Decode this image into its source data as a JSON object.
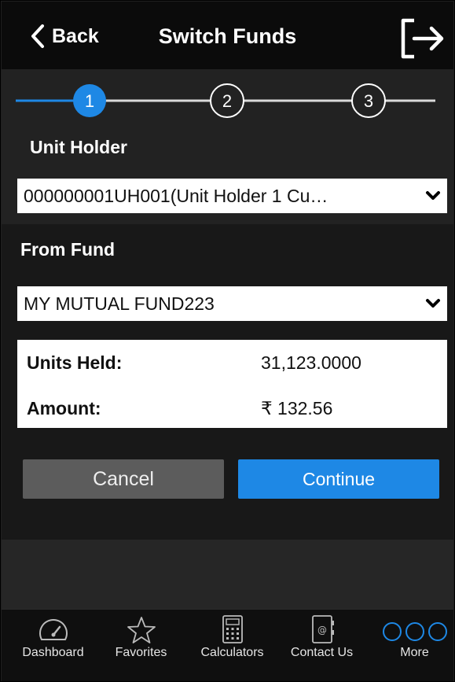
{
  "header": {
    "back_label": "Back",
    "title": "Switch Funds",
    "logout_icon": "logout-icon"
  },
  "stepper": {
    "steps": [
      "1",
      "2",
      "3"
    ],
    "active_step": 1,
    "active_color": "#1e88e5"
  },
  "unit_holder": {
    "label": "Unit Holder",
    "value": "000000001UH001(Unit Holder 1 Cu…"
  },
  "from_fund": {
    "label": "From Fund",
    "value": "MY MUTUAL FUND223"
  },
  "holding": {
    "units_label": "Units Held:",
    "units_value": "31,123.0000",
    "amount_label": "Amount:",
    "amount_value": "₹ 132.56"
  },
  "actions": {
    "cancel_label": "Cancel",
    "continue_label": "Continue"
  },
  "tabbar": {
    "items": [
      {
        "label": "Dashboard",
        "icon": "dashboard-gauge-icon"
      },
      {
        "label": "Favorites",
        "icon": "star-icon"
      },
      {
        "label": "Calculators",
        "icon": "calculator-icon"
      },
      {
        "label": "Contact Us",
        "icon": "contact-book-icon"
      },
      {
        "label": "More",
        "icon": "more-circles-icon"
      }
    ]
  },
  "colors": {
    "accent": "#1e88e5",
    "background": "#222222",
    "header": "#0b0b0b"
  }
}
